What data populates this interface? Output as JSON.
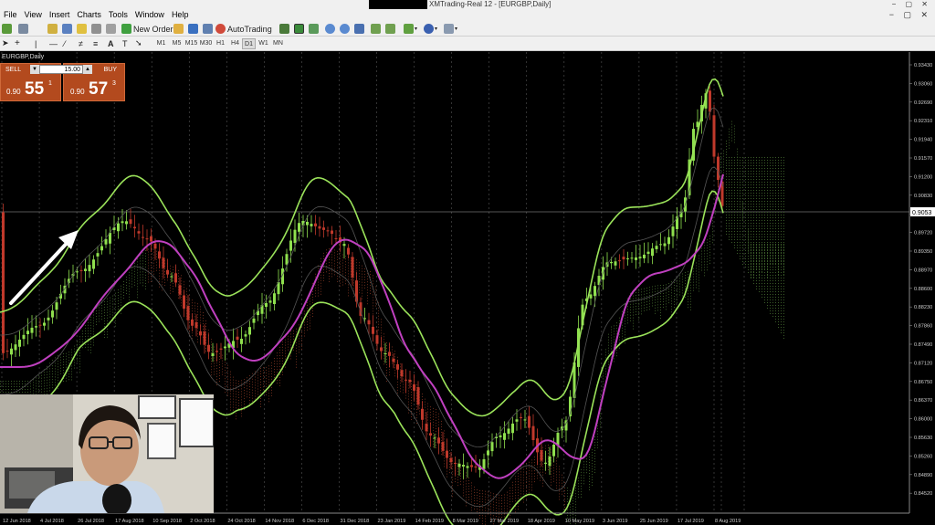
{
  "window": {
    "title": "XMTrading-Real 12 - [EURGBP,Daily]"
  },
  "menu": [
    "File",
    "View",
    "Insert",
    "Charts",
    "Tools",
    "Window",
    "Help"
  ],
  "toolbar": {
    "new_order": "New Order",
    "auto_trading": "AutoTrading"
  },
  "timeframes": [
    "M1",
    "M5",
    "M15",
    "M30",
    "H1",
    "H4",
    "D1",
    "W1",
    "MN"
  ],
  "active_timeframe": "D1",
  "chart": {
    "symbol_label": "EURGBP,Daily",
    "price_axis": [
      "0.93430",
      "0.93060",
      "0.92690",
      "0.92310",
      "0.91940",
      "0.91570",
      "0.91200",
      "0.90830",
      "0.90090",
      "0.89720",
      "0.89350",
      "0.88970",
      "0.88600",
      "0.88230",
      "0.87860",
      "0.87490",
      "0.87120",
      "0.86750",
      "0.86370",
      "0.86000",
      "0.85630",
      "0.85260",
      "0.84890",
      "0.84520"
    ],
    "current_price": "0.9053",
    "date_axis": [
      "12 Jun 2018",
      "4 Jul 2018",
      "26 Jul 2018",
      "17 Aug 2018",
      "10 Sep 2018",
      "2 Oct 2018",
      "24 Oct 2018",
      "14 Nov 2018",
      "6 Dec 2018",
      "31 Dec 2018",
      "23 Jan 2019",
      "14 Feb 2019",
      "8 Mar 2019",
      "27 Mar 2019",
      "18 Apr 2019",
      "10 May 2019",
      "3 Jun 2019",
      "25 Jun 2019",
      "17 Jul 2019",
      "8 Aug 2019"
    ]
  },
  "one_click": {
    "sell_label": "SELL",
    "buy_label": "BUY",
    "lot": "15.00",
    "sell_price": {
      "prefix": "0.90",
      "big": "55",
      "sup": "1"
    },
    "buy_price": {
      "prefix": "0.90",
      "big": "57",
      "sup": "3"
    }
  },
  "colors": {
    "bull": "#8fe04e",
    "bear": "#c0392b",
    "ma": "#c040c0",
    "bands": "#9be35a",
    "cloud_up": "#3a5a28",
    "cloud_down": "#6a2c1c"
  }
}
